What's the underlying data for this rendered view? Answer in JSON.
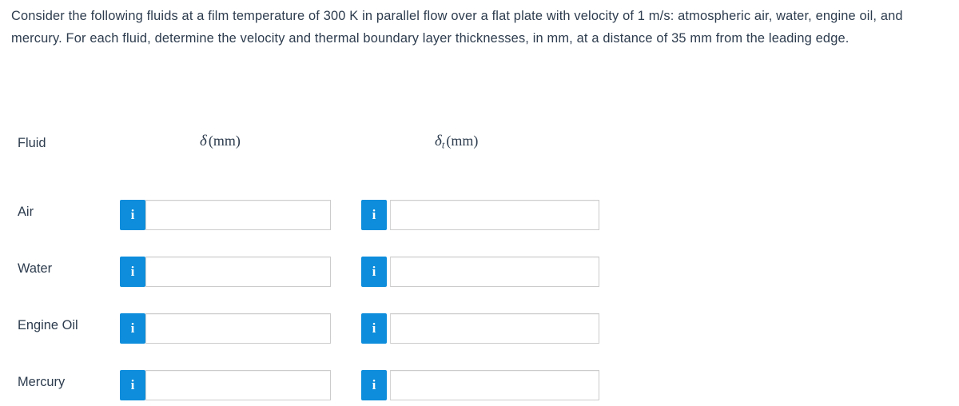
{
  "question": {
    "prompt": "Consider the following fluids at a film temperature of 300 K in parallel flow over a flat plate with velocity of 1 m/s: atmospheric air, water, engine oil, and mercury. For each fluid, determine the velocity and thermal boundary layer thicknesses, in mm, at a distance of 35 mm from the leading edge."
  },
  "table": {
    "headers": {
      "fluid": "Fluid",
      "delta_symbol": "δ",
      "delta_unit": "(mm)",
      "delta_t_symbol": "δ",
      "delta_t_subscript": "t",
      "delta_t_unit": "(mm)"
    },
    "rows": [
      {
        "fluid": "Air",
        "delta": {
          "value": "",
          "placeholder": "",
          "info_icon": "info-icon",
          "info_label": "i"
        },
        "delta_t": {
          "value": "",
          "placeholder": "",
          "info_icon": "info-icon",
          "info_label": "i"
        }
      },
      {
        "fluid": "Water",
        "delta": {
          "value": "",
          "placeholder": "",
          "info_icon": "info-icon",
          "info_label": "i"
        },
        "delta_t": {
          "value": "",
          "placeholder": "",
          "info_icon": "info-icon",
          "info_label": "i"
        }
      },
      {
        "fluid": "Engine Oil",
        "delta": {
          "value": "",
          "placeholder": "",
          "info_icon": "info-icon",
          "info_label": "i"
        },
        "delta_t": {
          "value": "",
          "placeholder": "",
          "info_icon": "info-icon",
          "info_label": "i"
        }
      },
      {
        "fluid": "Mercury",
        "delta": {
          "value": "",
          "placeholder": "",
          "info_icon": "info-icon",
          "info_label": "i"
        },
        "delta_t": {
          "value": "",
          "placeholder": "",
          "info_icon": "info-icon",
          "info_label": "i"
        }
      }
    ]
  },
  "colors": {
    "text": "#2d3c4e",
    "info_button": "#0d8ddb",
    "input_border": "#cccccc",
    "background": "#ffffff"
  }
}
